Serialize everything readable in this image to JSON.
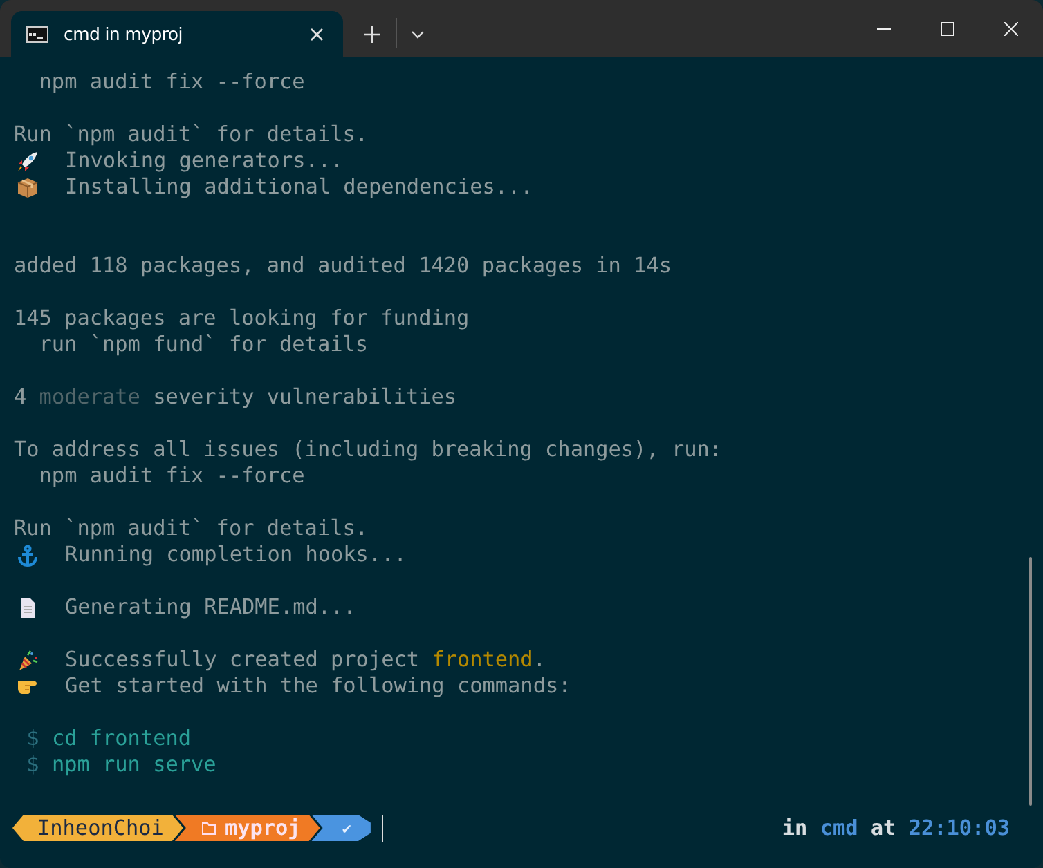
{
  "window": {
    "tab": {
      "title": "cmd in myproj",
      "selected": true
    }
  },
  "lines": [
    {
      "kind": "text",
      "segments": [
        {
          "text": "  npm audit fix --force",
          "kind": "plain"
        }
      ]
    },
    {
      "kind": "blank"
    },
    {
      "kind": "text",
      "segments": [
        {
          "text": "Run `npm audit` for details.",
          "kind": "plain"
        }
      ]
    },
    {
      "kind": "emoji",
      "segments": [
        {
          "text": "Invoking generators...",
          "kind": "plain"
        }
      ]
    },
    {
      "kind": "emoji",
      "segments": [
        {
          "text": "Installing additional dependencies...",
          "kind": "plain"
        }
      ]
    },
    {
      "kind": "blank"
    },
    {
      "kind": "blank"
    },
    {
      "kind": "text",
      "segments": [
        {
          "text": "added 118 packages, and audited 1420 packages in 14s",
          "kind": "plain"
        }
      ]
    },
    {
      "kind": "blank"
    },
    {
      "kind": "text",
      "segments": [
        {
          "text": "145 packages are looking for funding",
          "kind": "plain"
        }
      ]
    },
    {
      "kind": "text",
      "segments": [
        {
          "text": "  run `npm fund` for details",
          "kind": "plain"
        }
      ]
    },
    {
      "kind": "blank"
    },
    {
      "kind": "text",
      "segments": [
        {
          "text": "4 ",
          "kind": "plain"
        },
        {
          "text": "moderate",
          "kind": "dim"
        },
        {
          "text": " severity vulnerabilities",
          "kind": "plain"
        }
      ]
    },
    {
      "kind": "blank"
    },
    {
      "kind": "text",
      "segments": [
        {
          "text": "To address all issues (including breaking changes), run:",
          "kind": "plain"
        }
      ]
    },
    {
      "kind": "text",
      "segments": [
        {
          "text": "  npm audit fix --force",
          "kind": "plain"
        }
      ]
    },
    {
      "kind": "blank"
    },
    {
      "kind": "text",
      "segments": [
        {
          "text": "Run `npm audit` for details.",
          "kind": "plain"
        }
      ]
    },
    {
      "kind": "emoji",
      "segments": [
        {
          "text": "Running completion hooks...",
          "kind": "plain"
        }
      ]
    },
    {
      "kind": "blank"
    },
    {
      "kind": "emoji",
      "segments": [
        {
          "text": "Generating README.md...",
          "kind": "plain"
        }
      ]
    },
    {
      "kind": "blank"
    },
    {
      "kind": "emoji",
      "segments": [
        {
          "text": "Successfully created project ",
          "kind": "plain"
        },
        {
          "text": "frontend",
          "kind": "accent"
        },
        {
          "text": ".",
          "kind": "plain"
        }
      ]
    },
    {
      "kind": "emoji",
      "segments": [
        {
          "text": "Get started with the following commands:",
          "kind": "plain"
        }
      ]
    },
    {
      "kind": "blank"
    },
    {
      "kind": "command",
      "segments": [
        {
          "text": " $ ",
          "kind": "prompt"
        },
        {
          "text": "cd frontend",
          "kind": "command"
        }
      ]
    },
    {
      "kind": "command",
      "segments": [
        {
          "text": " $ ",
          "kind": "prompt"
        },
        {
          "text": "npm run serve",
          "kind": "command"
        }
      ]
    }
  ],
  "prompt": {
    "segments": [
      {
        "kind": "user",
        "text": "InheonChoi"
      },
      {
        "kind": "folder",
        "text": "myproj"
      },
      {
        "kind": "status",
        "text": "✔"
      }
    ],
    "right": [
      {
        "text": "in ",
        "kind": "plain"
      },
      {
        "text": "cmd",
        "kind": "info"
      },
      {
        "text": " at ",
        "kind": "plain"
      },
      {
        "text": "22:10:03",
        "kind": "info"
      }
    ]
  }
}
